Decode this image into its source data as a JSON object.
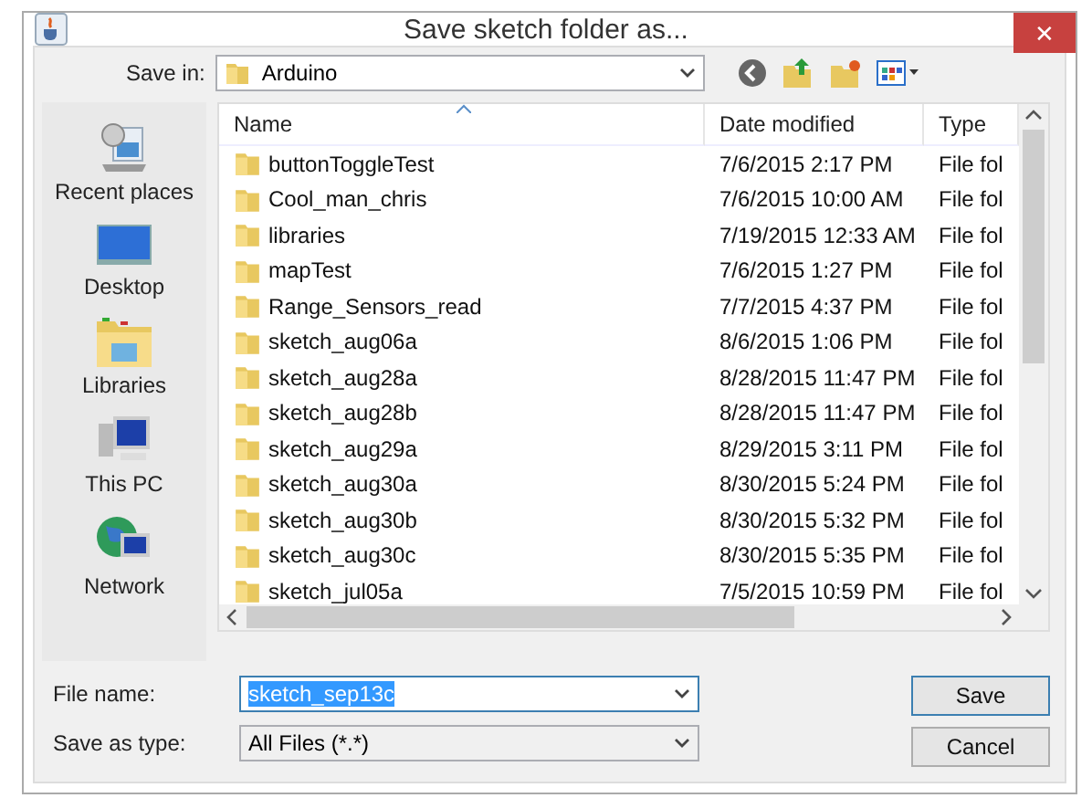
{
  "window": {
    "title": "Save sketch folder as...",
    "close": "✕"
  },
  "save_in": {
    "label": "Save in:",
    "value": "Arduino"
  },
  "places": [
    {
      "kind": "recent",
      "label": "Recent places"
    },
    {
      "kind": "desktop",
      "label": "Desktop"
    },
    {
      "kind": "libraries",
      "label": "Libraries"
    },
    {
      "kind": "pc",
      "label": "This PC"
    },
    {
      "kind": "network",
      "label": "Network"
    }
  ],
  "table": {
    "columns": [
      "Name",
      "Date modified",
      "Type"
    ],
    "rows": [
      {
        "name": "buttonToggleTest",
        "date": "7/6/2015 2:17 PM",
        "type": "File fol"
      },
      {
        "name": "Cool_man_chris",
        "date": "7/6/2015 10:00 AM",
        "type": "File fol"
      },
      {
        "name": "libraries",
        "date": "7/19/2015 12:33 AM",
        "type": "File fol"
      },
      {
        "name": "mapTest",
        "date": "7/6/2015 1:27 PM",
        "type": "File fol"
      },
      {
        "name": "Range_Sensors_read",
        "date": "7/7/2015 4:37 PM",
        "type": "File fol"
      },
      {
        "name": "sketch_aug06a",
        "date": "8/6/2015 1:06 PM",
        "type": "File fol"
      },
      {
        "name": "sketch_aug28a",
        "date": "8/28/2015 11:47 PM",
        "type": "File fol"
      },
      {
        "name": "sketch_aug28b",
        "date": "8/28/2015 11:47 PM",
        "type": "File fol"
      },
      {
        "name": "sketch_aug29a",
        "date": "8/29/2015 3:11 PM",
        "type": "File fol"
      },
      {
        "name": "sketch_aug30a",
        "date": "8/30/2015 5:24 PM",
        "type": "File fol"
      },
      {
        "name": "sketch_aug30b",
        "date": "8/30/2015 5:32 PM",
        "type": "File fol"
      },
      {
        "name": "sketch_aug30c",
        "date": "8/30/2015 5:35 PM",
        "type": "File fol"
      },
      {
        "name": "sketch_jul05a",
        "date": "7/5/2015 10:59 PM",
        "type": "File fol"
      }
    ]
  },
  "file_name": {
    "label": "File name:",
    "value": "sketch_sep13c",
    "value_selected": true
  },
  "save_as_type": {
    "label": "Save as type:",
    "value": "All Files (*.*)"
  },
  "buttons": [
    {
      "label": "Save",
      "default": true
    },
    {
      "label": "Cancel",
      "default": false
    }
  ]
}
